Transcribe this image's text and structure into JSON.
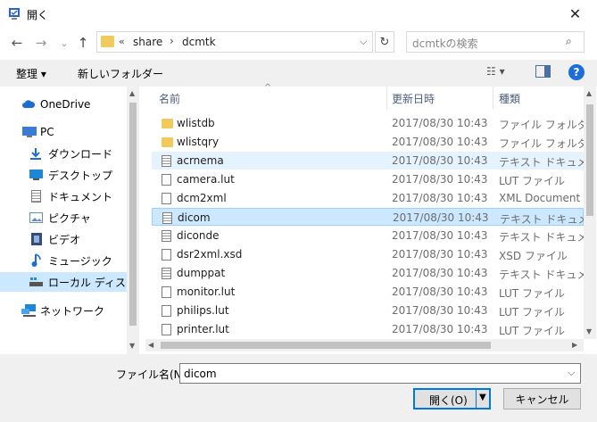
{
  "window": {
    "title": "開く",
    "close_glyph": "✕"
  },
  "nav": {
    "back": "←",
    "forward": "→",
    "recent": "⌄",
    "up": "↑",
    "address_overflow": "«",
    "breadcrumbs": [
      "share",
      "dcmtk"
    ],
    "breadcrumb_sep": "›",
    "address_dropdown": "⌵",
    "refresh": "↻",
    "search_placeholder": "dcmtkの検索",
    "search_icon": "⌕"
  },
  "toolbar": {
    "organize": "整理 ▾",
    "new_folder": "新しいフォルダー",
    "view": "☷ ▾",
    "help": "?"
  },
  "sidebar": {
    "items": [
      {
        "label": "OneDrive",
        "icon": "cloud-icon",
        "color": "#1a6fd1"
      },
      {
        "label": "PC",
        "icon": "computer-icon",
        "color": "#3a7bd5"
      },
      {
        "label": "ダウンロード",
        "icon": "download-icon",
        "color": "#1a6fd1"
      },
      {
        "label": "デスクトップ",
        "icon": "desktop-icon",
        "color": "#1c87d6"
      },
      {
        "label": "ドキュメント",
        "icon": "document-icon",
        "color": "#8c8c8c"
      },
      {
        "label": "ピクチャ",
        "icon": "pictures-icon",
        "color": "#6a8cb5"
      },
      {
        "label": "ビデオ",
        "icon": "video-icon",
        "color": "#334c7a"
      },
      {
        "label": "ミュージック",
        "icon": "music-icon",
        "color": "#1a6fd1"
      },
      {
        "label": "ローカル ディスク (C",
        "icon": "disk-icon",
        "color": "#555555"
      },
      {
        "label": "ネットワーク",
        "icon": "network-icon",
        "color": "#1c87d6"
      }
    ]
  },
  "columns": {
    "name": "名前",
    "date": "更新日時",
    "type": "種類",
    "sort": "^"
  },
  "files": [
    {
      "name": "wlistdb",
      "date": "2017/08/30 10:43",
      "type": "ファイル フォルダー",
      "kind": "folder"
    },
    {
      "name": "wlistqry",
      "date": "2017/08/30 10:43",
      "type": "ファイル フォルダー",
      "kind": "folder"
    },
    {
      "name": "acrnema",
      "date": "2017/08/30 10:43",
      "type": "テキスト ドキュメント",
      "kind": "text"
    },
    {
      "name": "camera.lut",
      "date": "2017/08/30 10:43",
      "type": "LUT ファイル",
      "kind": "doc"
    },
    {
      "name": "dcm2xml",
      "date": "2017/08/30 10:43",
      "type": "XML Document Ty",
      "kind": "doc"
    },
    {
      "name": "dicom",
      "date": "2017/08/30 10:43",
      "type": "テキスト ドキュメント",
      "kind": "text"
    },
    {
      "name": "diconde",
      "date": "2017/08/30 10:43",
      "type": "テキスト ドキュメント",
      "kind": "text"
    },
    {
      "name": "dsr2xml.xsd",
      "date": "2017/08/30 10:43",
      "type": "XSD ファイル",
      "kind": "doc"
    },
    {
      "name": "dumppat",
      "date": "2017/08/30 10:43",
      "type": "テキスト ドキュメント",
      "kind": "text"
    },
    {
      "name": "monitor.lut",
      "date": "2017/08/30 10:43",
      "type": "LUT ファイル",
      "kind": "doc"
    },
    {
      "name": "philips.lut",
      "date": "2017/08/30 10:43",
      "type": "LUT ファイル",
      "kind": "doc"
    },
    {
      "name": "printer.lut",
      "date": "2017/08/30 10:43",
      "type": "LUT ファイル",
      "kind": "doc"
    }
  ],
  "scroll": {
    "up": "▲",
    "down": "▼",
    "left": "◀",
    "right": "▶"
  },
  "bottom": {
    "filename_label": "ファイル名(N):",
    "filename_value": "dicom",
    "dropdown": "⌵",
    "open": "開く(O)",
    "open_dropdown": "▼",
    "cancel": "キャンセル"
  }
}
